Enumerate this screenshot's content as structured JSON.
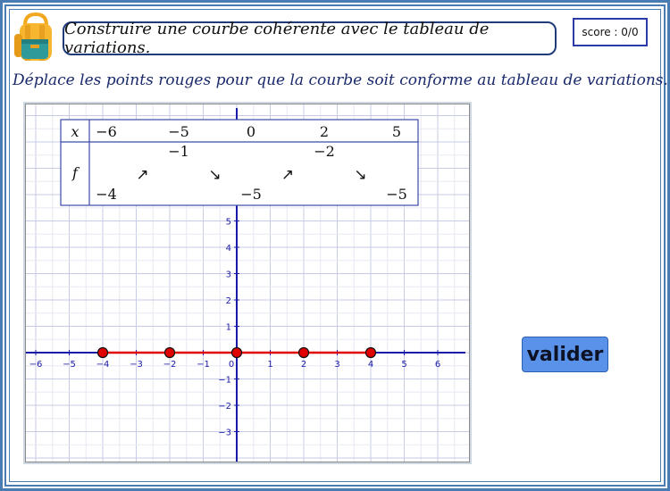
{
  "header": {
    "title": "Construire une courbe cohérente avec le tableau de variations.",
    "score": "score : 0/0"
  },
  "instruction": "Déplace les points rouges pour que la courbe soit conforme au tableau de variations.",
  "variation_table": {
    "x_label": "x",
    "f_label": "f",
    "x_values": [
      "−6",
      "−5",
      "0",
      "2",
      "5"
    ],
    "f_values": [
      "−4",
      "−1",
      "−5",
      "−2",
      "−5"
    ],
    "f_levels": [
      "low",
      "high",
      "low",
      "high",
      "low"
    ],
    "arrows": [
      "↗",
      "↘",
      "↗",
      "↘"
    ]
  },
  "graph": {
    "x_ticks": [
      "−6",
      "−5",
      "−4",
      "−3",
      "−2",
      "−1",
      "0",
      "1",
      "2",
      "3",
      "4",
      "5",
      "6"
    ],
    "y_ticks": [
      "5",
      "4",
      "3",
      "2",
      "1",
      "−1",
      "−2",
      "−3"
    ],
    "curve_color": "#e00000",
    "point_color": "#e00000",
    "points": [
      {
        "x": -4,
        "y": 0
      },
      {
        "x": -2,
        "y": 0
      },
      {
        "x": 0,
        "y": 0
      },
      {
        "x": 2,
        "y": 0
      },
      {
        "x": 4,
        "y": 0
      }
    ]
  },
  "button": {
    "label": "valider",
    "color": "#5a92ea"
  },
  "icon": "school-backpack-icon"
}
